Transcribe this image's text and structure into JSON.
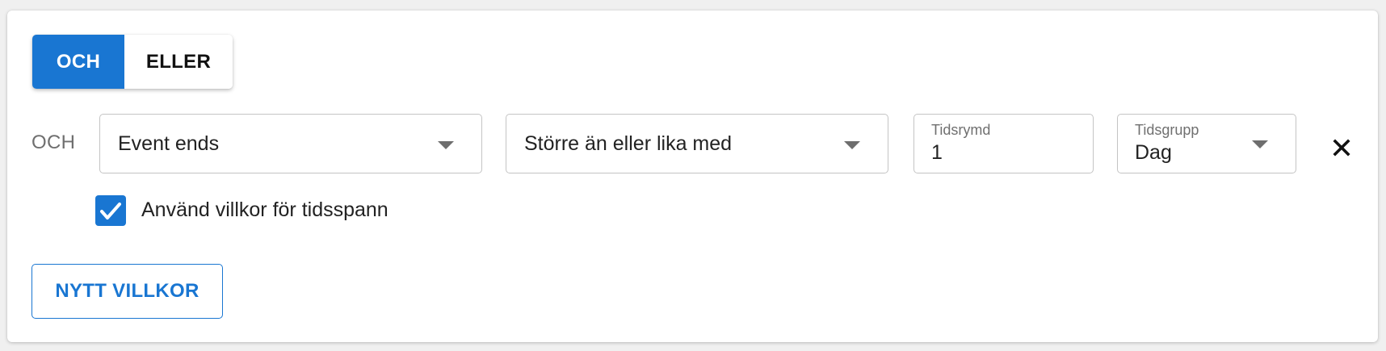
{
  "logic_toggle": {
    "options": [
      {
        "label": "OCH",
        "selected": true
      },
      {
        "label": "ELLER",
        "selected": false
      }
    ]
  },
  "condition": {
    "operator_label": "OCH",
    "field": {
      "value": "Event ends"
    },
    "comparison": {
      "value": "Större än eller lika med"
    },
    "time_span": {
      "label": "Tidsrymd",
      "value": "1"
    },
    "time_group": {
      "label": "Tidsgrupp",
      "value": "Dag"
    },
    "use_timespan": {
      "label": "Använd villkor för tidsspann",
      "checked": true
    }
  },
  "actions": {
    "new_condition_label": "NYTT VILLKOR"
  },
  "icons": {
    "remove": "close-icon",
    "dropdown": "caret-down-icon",
    "check": "check-icon"
  },
  "colors": {
    "primary": "#1976d2",
    "text": "#222222",
    "muted": "#6f6f6f",
    "border": "#c4c4c4"
  }
}
